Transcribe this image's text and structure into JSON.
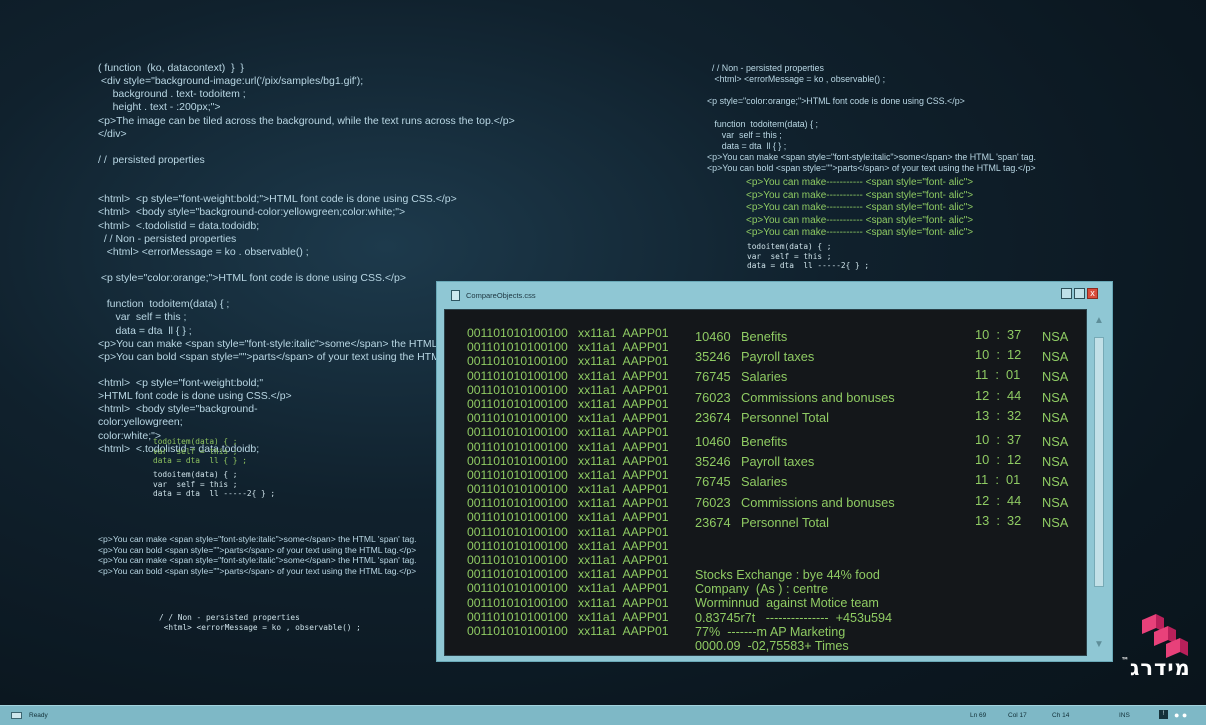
{
  "background": {
    "left_code": [
      "( function  (ko, datacontext)  }  }",
      " <div style=\"background-image:url('/pix/samples/bg1.gif');",
      "     background . text- todoitem ;",
      "     height . text - :200px;\">",
      "<p>The image can be tiled across the background, while the text runs across the top.</p>",
      "</div>",
      "",
      "/ /  persisted properties",
      "",
      "",
      "<html>  <p style=\"font-weight:bold;\">HTML font code is done using CSS.</p>",
      "<html>  <body style=\"background-color:yellowgreen;color:white;\">",
      "<html>  <.todolistid = data.todoidb;",
      "  / / Non - persisted properties",
      "   <html> <errorMessage = ko . observable() ;",
      "",
      " <p style=\"color:orange;\">HTML font code is done using CSS.</p>",
      "",
      "   function  todoitem(data) { ;",
      "      var  self = this ;",
      "      data = dta  ll { } ;",
      "<p>You can make <span style=\"font-style:italic\">some</span> the HTML 'span' tag.",
      "<p>You can bold <span style=\"\">parts</span> of your text using the HTML tag.</p>",
      "",
      "<html>  <p style=\"font-weight:bold;\"",
      ">HTML font code is done using CSS.</p>",
      "<html>  <body style=\"background-",
      "color:yellowgreen;",
      "color:white;\">",
      "<html>  <.todolistid = data.todoidb;"
    ],
    "left_mono_green": [
      "todoitem(data) { ;",
      "var  self = this ;",
      "data = dta  ll { } ;"
    ],
    "left_mono": [
      "todoitem(data) { ;",
      "var  self = this ;",
      "data = dta  ll -----2{ } ;"
    ],
    "left_bottom_code": [
      "<p>You can make <span style=\"font-style:italic\">some</span> the HTML 'span' tag.",
      "<p>You can bold <span style=\"\">parts</span> of your text using the HTML tag.</p>",
      "<p>You can make <span style=\"font-style:italic\">some</span> the HTML 'span' tag.",
      "<p>You can bold <span style=\"\">parts</span> of your text using the HTML tag.</p>"
    ],
    "left_bottom_mono": [
      "/ / Non - persisted properties",
      " <html> <errorMessage = ko , observable() ;"
    ],
    "right_code": [
      "  / / Non - persisted properties",
      "   <html> <errorMessage = ko , observable() ;",
      "",
      "<p style=\"color:orange;\">HTML font code is done using CSS.</p>",
      "",
      "   function  todoitem(data) { ;",
      "      var  self = this ;",
      "      data = dta  ll { } ;",
      "<p>You can make <span style=\"font-style:italic\">some</span> the HTML 'span' tag.",
      "<p>You can bold <span style=\"\">parts</span> of your text using the HTML tag.</p>"
    ],
    "right_green": [
      "<p>You can make----------- <span style=\"font- alic\">",
      "<p>You can make----------- <span style=\"font- alic\">",
      "<p>You can make----------- <span style=\"font- alic\">",
      "<p>You can make----------- <span style=\"font- alic\">",
      "<p>You can make----------- <span style=\"font- alic\">"
    ],
    "right_mono": [
      "todoitem(data) { ;",
      "var  self = this ;",
      "data = dta  ll -----2{ } ;"
    ]
  },
  "window": {
    "title": "CompareObjects.css",
    "close_glyph": "x",
    "binary_rows": [
      "001101010100100",
      "001101010100100",
      "001101010100100",
      "001101010100100",
      "001101010100100",
      "001101010100100",
      "001101010100100",
      "001101010100100",
      "001101010100100",
      "001101010100100",
      "001101010100100",
      "001101010100100",
      "001101010100100",
      "001101010100100",
      "001101010100100",
      "001101010100100",
      "001101010100100",
      "001101010100100",
      "001101010100100",
      "001101010100100",
      "001101010100100",
      "001101010100100"
    ],
    "code_rows": [
      "xx11a1  AAPP01",
      "xx11a1  AAPP01",
      "xx11a1  AAPP01",
      "xx11a1  AAPP01",
      "xx11a1  AAPP01",
      "xx11a1  AAPP01",
      "xx11a1  AAPP01",
      "xx11a1  AAPP01",
      "xx11a1  AAPP01",
      "xx11a1  AAPP01",
      "xx11a1  AAPP01",
      "xx11a1  AAPP01",
      "xx11a1  AAPP01",
      "xx11a1  AAPP01",
      "xx11a1  AAPP01",
      "xx11a1  AAPP01",
      "xx11a1  AAPP01",
      "xx11a1  AAPP01",
      "xx11a1  AAPP01",
      "xx11a1  AAPP01",
      "xx11a1  AAPP01",
      "xx11a1  AAPP01"
    ],
    "entries": [
      {
        "code": "10460",
        "label": "Benefits",
        "time": "10  :  37",
        "tag": "NSA"
      },
      {
        "code": "35246",
        "label": "Payroll taxes",
        "time": "10  :  12",
        "tag": "NSA"
      },
      {
        "code": "76745",
        "label": "Salaries",
        "time": "11  :  01",
        "tag": "NSA"
      },
      {
        "code": "76023",
        "label": "Commissions and bonuses",
        "time": "12  :  44",
        "tag": "NSA"
      },
      {
        "code": "23674",
        "label": "Personnel Total",
        "time": "13  :  32",
        "tag": "NSA"
      },
      {
        "code": "10460",
        "label": "Benefits",
        "time": "10  :  37",
        "tag": "NSA"
      },
      {
        "code": "35246",
        "label": "Payroll taxes",
        "time": "10  :  12",
        "tag": "NSA"
      },
      {
        "code": "76745",
        "label": "Salaries",
        "time": "11  :  01",
        "tag": "NSA"
      },
      {
        "code": "76023",
        "label": "Commissions and bonuses",
        "time": "12  :  44",
        "tag": "NSA"
      },
      {
        "code": "23674",
        "label": "Personnel Total",
        "time": "13  :  32",
        "tag": "NSA"
      }
    ],
    "notes": [
      "Stocks Exchange : bye 44% food",
      "Company  (As ) : centre",
      "Worminnud  against Motice team",
      "0.83745r7t   ---------------  +453u594",
      "77%  -------m AP Marketing",
      "0000.09  -02,75583+ Times"
    ]
  },
  "logo": {
    "text": "מידרג",
    "mark": "™"
  },
  "statusbar": {
    "ready": "Ready",
    "ln": "Ln 69",
    "col": "Col 17",
    "ch": "Ch 14",
    "ins": "INS"
  },
  "colors": {
    "accent": "#8fcb63",
    "frame": "#8fc7d4",
    "close": "#d94c3c",
    "logo": "#e8417a"
  }
}
